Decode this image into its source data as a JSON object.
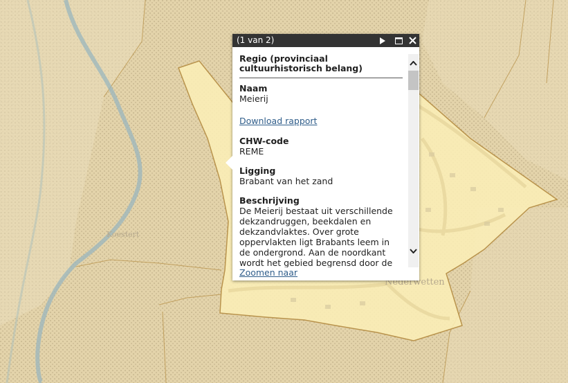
{
  "map": {
    "place_labels": [
      {
        "id": "nederwetten",
        "text": "Nederwetten"
      },
      {
        "id": "koestert",
        "text": "Koestert"
      }
    ],
    "colors": {
      "background": "#e7d8b1",
      "region_fill": "#fbeeb6",
      "region_border": "#b9934c",
      "river": "#9ab6bd"
    }
  },
  "popup": {
    "header": {
      "counter": "(1 van 2)"
    },
    "title": "Regio (provinciaal cultuurhistorisch belang)",
    "fields": [
      {
        "label": "Naam",
        "value": "Meierij"
      },
      {
        "label": "CHW-code",
        "value": "REME"
      },
      {
        "label": "Ligging",
        "value": "Brabant van het zand"
      },
      {
        "label": "Beschrijving",
        "value": "De Meierij bestaat uit verschillende dekzandruggen, beekdalen en dekzandvlaktes. Over grote oppervlakten ligt Brabants leem in de ondergrond. Aan de noordkant wordt het gebied begrensd door de grote en"
      }
    ],
    "download_link": "Download rapport",
    "zoom_link": "Zoomen naar"
  }
}
